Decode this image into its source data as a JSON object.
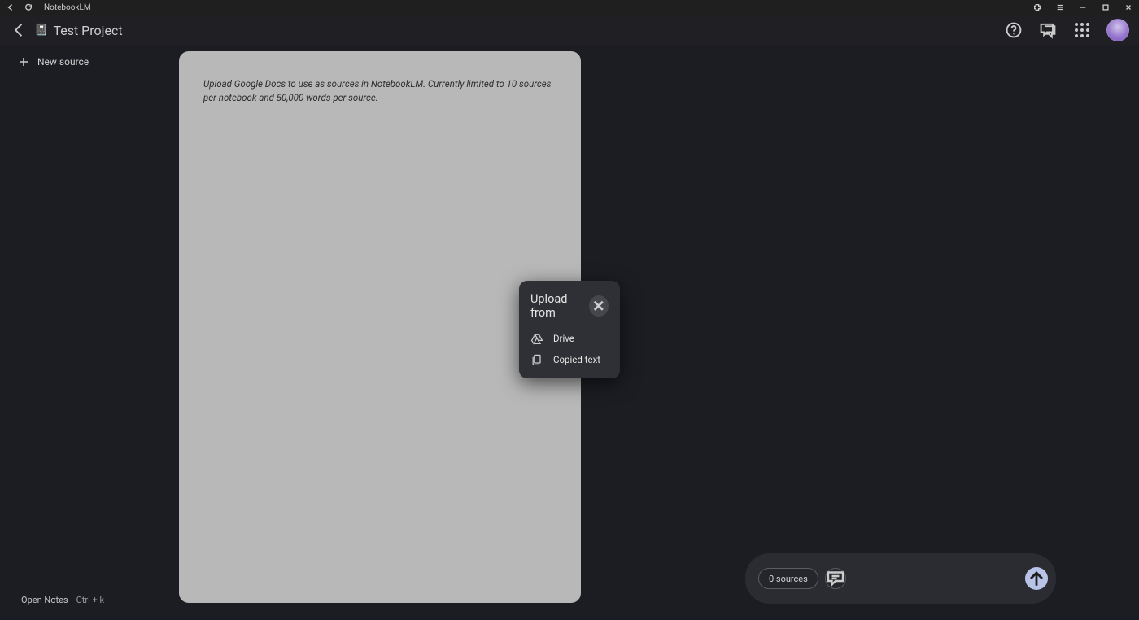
{
  "window": {
    "title": "NotebookLM"
  },
  "header": {
    "project_title": "Test Project",
    "notebook_emoji": "📓"
  },
  "sidebar": {
    "new_source_label": "New source"
  },
  "footer": {
    "open_notes_label": "Open Notes",
    "shortcut_label": "Ctrl + k"
  },
  "document": {
    "placeholder_text": "Upload Google Docs to use as sources in NotebookLM. Currently limited to 10 sources per notebook and 50,000 words per source."
  },
  "popover": {
    "title": "Upload from",
    "items": [
      {
        "label": "Drive",
        "icon": "drive-icon"
      },
      {
        "label": "Copied text",
        "icon": "copied-text-icon"
      }
    ]
  },
  "composer": {
    "sources_label": "0 sources"
  }
}
